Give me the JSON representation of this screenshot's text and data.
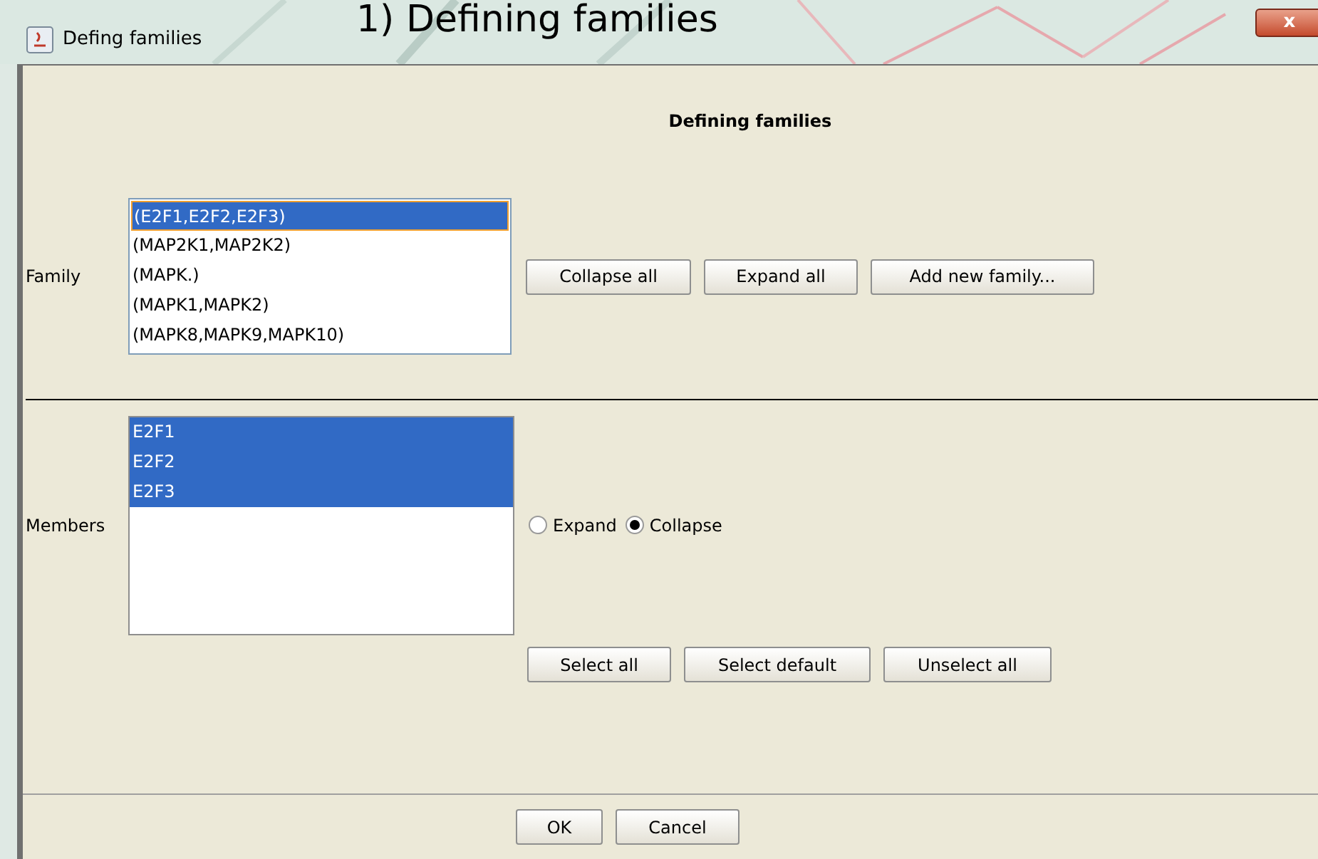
{
  "caption": "1) Defining families",
  "window": {
    "title": "Defing families",
    "close": "x"
  },
  "heading": "Defining families",
  "family": {
    "label": "Family",
    "items": [
      {
        "text": "(E2F1,E2F2,E2F3)",
        "selected": true
      },
      {
        "text": "(MAP2K1,MAP2K2)",
        "selected": false
      },
      {
        "text": "(MAPK.)",
        "selected": false
      },
      {
        "text": "(MAPK1,MAPK2)",
        "selected": false
      },
      {
        "text": "(MAPK8,MAPK9,MAPK10)",
        "selected": false
      }
    ],
    "buttons": [
      "Collapse all",
      "Expand all",
      "Add new family..."
    ]
  },
  "members": {
    "label": "Members",
    "items": [
      {
        "text": "E2F1",
        "selected": true
      },
      {
        "text": "E2F2",
        "selected": true
      },
      {
        "text": "E2F3",
        "selected": true
      }
    ],
    "radios": [
      {
        "label": "Expand",
        "selected": false
      },
      {
        "label": "Collapse",
        "selected": true
      }
    ],
    "buttons": [
      "Select all",
      "Select default",
      "Unselect all"
    ]
  },
  "footer_buttons": [
    "OK",
    "Cancel"
  ]
}
